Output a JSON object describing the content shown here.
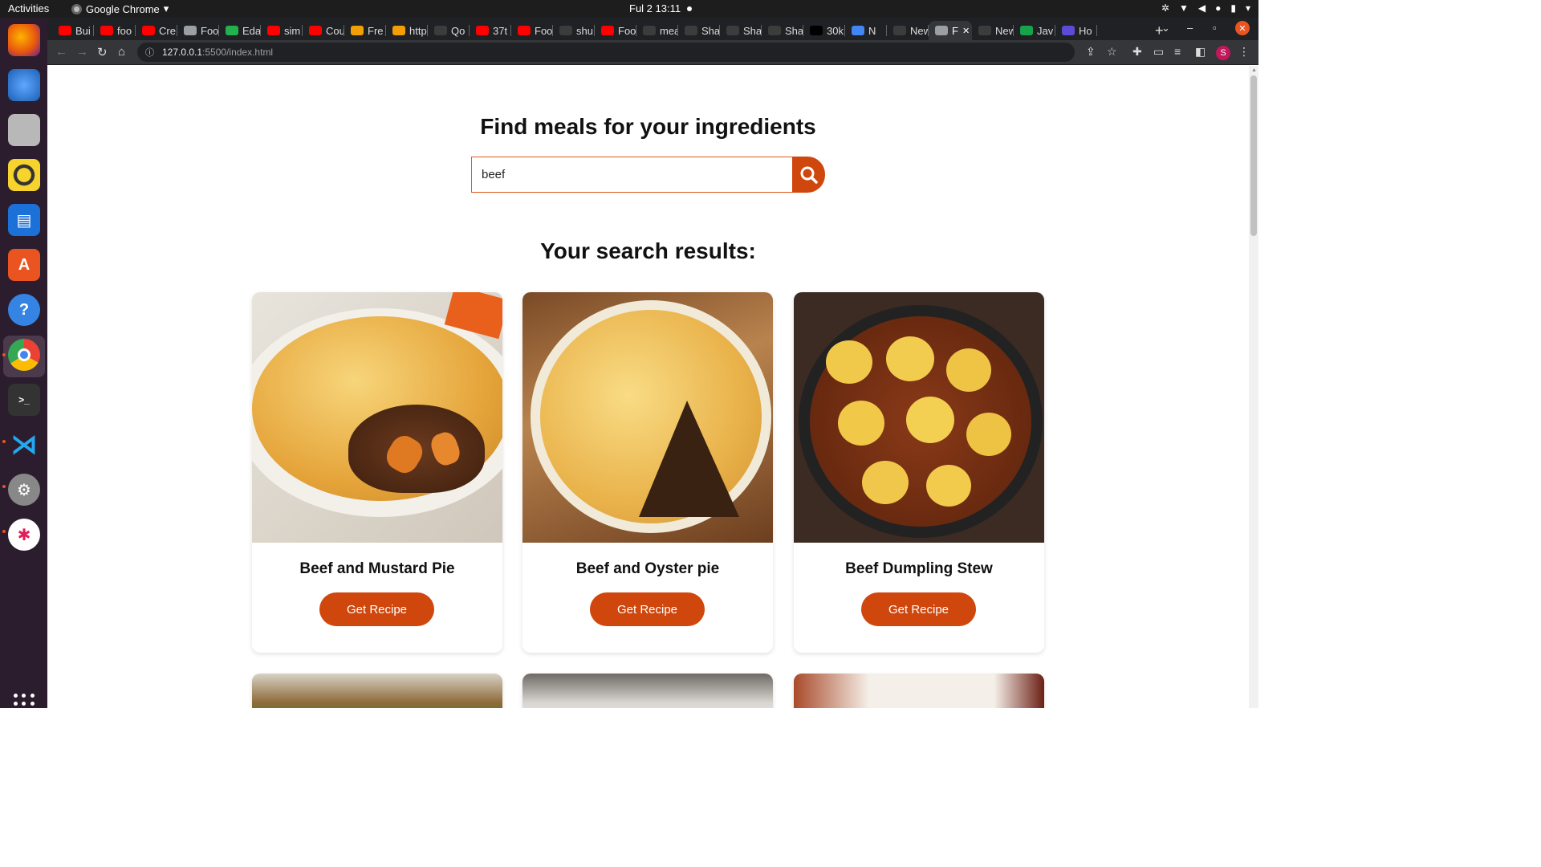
{
  "os": {
    "activities": "Activities",
    "app_name": "Google Chrome",
    "clock": "Ful 2  13:11"
  },
  "browser": {
    "tabs": [
      {
        "label": "Bui",
        "fav": "youtube-icon"
      },
      {
        "label": "foo",
        "fav": "youtube-icon"
      },
      {
        "label": "Cre",
        "fav": "youtube-icon"
      },
      {
        "label": "Foo",
        "fav": "globe-icon"
      },
      {
        "label": "Eda",
        "fav": "edamam-icon"
      },
      {
        "label": "sim",
        "fav": "youtube-icon"
      },
      {
        "label": "Cou",
        "fav": "youtube-icon"
      },
      {
        "label": "Fre",
        "fav": "food-icon"
      },
      {
        "label": "http",
        "fav": "food-icon"
      },
      {
        "label": "Qo",
        "fav": "github-icon"
      },
      {
        "label": "37t",
        "fav": "youtube-icon"
      },
      {
        "label": "Foo",
        "fav": "youtube-icon"
      },
      {
        "label": "shu",
        "fav": "github-icon"
      },
      {
        "label": "Foo",
        "fav": "youtube-icon"
      },
      {
        "label": "mea",
        "fav": "github-icon"
      },
      {
        "label": "Sha",
        "fav": "github-icon"
      },
      {
        "label": "Sha",
        "fav": "github-icon"
      },
      {
        "label": "Sha",
        "fav": "github-icon"
      },
      {
        "label": "30k",
        "fav": "people-icon"
      },
      {
        "label": "N",
        "fav": "google-icon"
      },
      {
        "label": "New",
        "fav": "github-icon"
      },
      {
        "label": "F",
        "fav": "globe-icon",
        "active": true
      },
      {
        "label": "New",
        "fav": "github-icon"
      },
      {
        "label": "Jav",
        "fav": "w-icon"
      },
      {
        "label": "Ho",
        "fav": "a-icon"
      }
    ],
    "url_host": "127.0.0.1",
    "url_path": ":5500/index.html",
    "profile_initial": "S"
  },
  "page": {
    "heading": "Find meals for your ingredients",
    "search_value": "beef",
    "results_heading": "Your search results:",
    "button_label": "Get Recipe",
    "meals": [
      {
        "name": "Beef and Mustard Pie"
      },
      {
        "name": "Beef and Oyster pie"
      },
      {
        "name": "Beef Dumpling Stew"
      }
    ]
  },
  "colors": {
    "accent": "#d0470e",
    "dock": "#2b1d2d",
    "topbar": "#1d1d1d"
  }
}
